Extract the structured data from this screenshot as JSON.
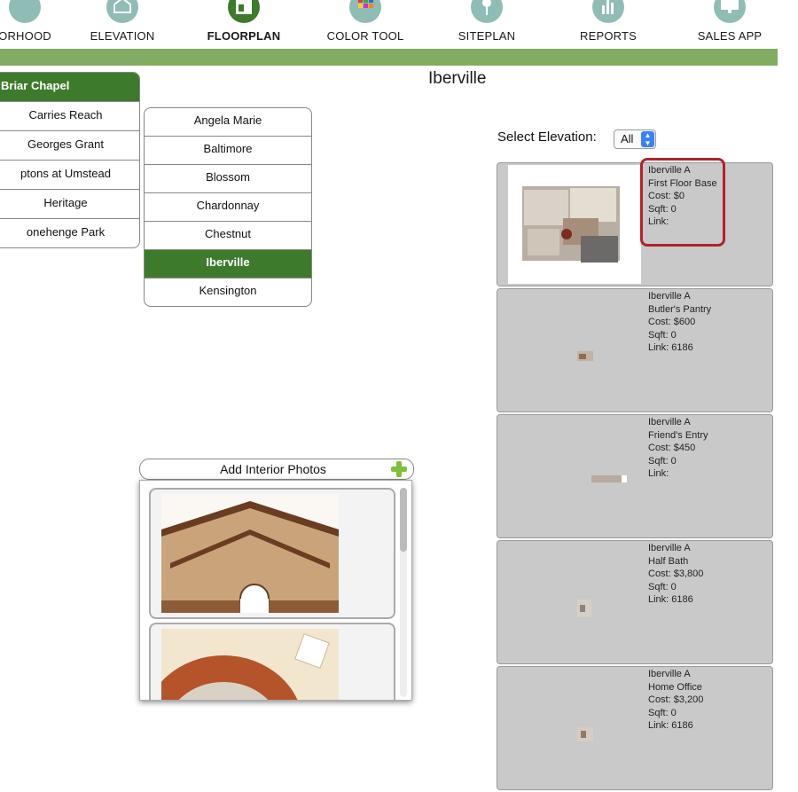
{
  "nav": {
    "items": [
      {
        "label": "ORHOOD",
        "icon": "neighborhood-icon"
      },
      {
        "label": "ELEVATION",
        "icon": "house-icon"
      },
      {
        "label": "FLOORPLAN",
        "icon": "floorplan-icon",
        "active": true
      },
      {
        "label": "COLOR TOOL",
        "icon": "palette-icon"
      },
      {
        "label": "SITEPLAN",
        "icon": "map-pin-icon"
      },
      {
        "label": "REPORTS",
        "icon": "bar-chart-icon"
      },
      {
        "label": "SALES APP",
        "icon": "monitor-icon"
      }
    ],
    "accent": "#83ac63",
    "active_color": "#3e7a2c"
  },
  "page_title": "Iberville",
  "communities": [
    "Briar Chapel",
    "Carries Reach",
    "Georges Grant",
    "ptons at Umstead",
    "Heritage",
    "onehenge Park"
  ],
  "plans": [
    "Angela Marie",
    "Baltimore",
    "Blossom",
    "Chardonnay",
    "Chestnut",
    "Iberville",
    "Kensington"
  ],
  "elevation": {
    "label": "Select Elevation:",
    "value": "All"
  },
  "options": [
    {
      "elevation": "Iberville A",
      "name": "First Floor Base",
      "cost": "Cost:  $0",
      "sqft": "Sqft:   0",
      "link": "Link:"
    },
    {
      "elevation": "Iberville A",
      "name": "Butler's Pantry",
      "cost": "Cost:  $600",
      "sqft": "Sqft:   0",
      "link": "Link: 6186"
    },
    {
      "elevation": "Iberville A",
      "name": "Friend's Entry",
      "cost": "Cost:  $450",
      "sqft": "Sqft:   0",
      "link": "Link:"
    },
    {
      "elevation": "Iberville A",
      "name": "Half Bath",
      "cost": "Cost:  $3,800",
      "sqft": "Sqft:   0",
      "link": "Link: 6186"
    },
    {
      "elevation": "Iberville A",
      "name": "Home Office",
      "cost": "Cost:  $3,200",
      "sqft": "Sqft:   0",
      "link": "Link: 6186"
    }
  ],
  "photos": {
    "header": "Add Interior Photos",
    "add_icon": "plus-icon"
  },
  "highlight_color": "#b3222a"
}
